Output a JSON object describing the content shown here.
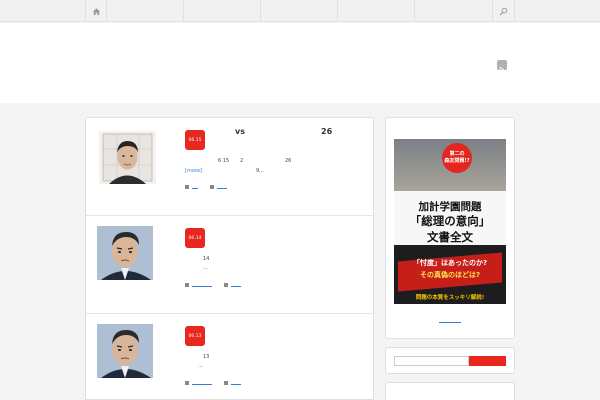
{
  "nav": {
    "home_icon": "home-icon",
    "search_icon": "search-icon"
  },
  "header": {
    "rss_icon": "rss-icon"
  },
  "posts": [
    {
      "date": "06.15",
      "title_a": "vs",
      "title_b": "26",
      "line1_a": "6 15",
      "line1_b": "2",
      "line1_c": "26",
      "more": "[more]",
      "line2_tail": "9..."
    },
    {
      "date": "06.14",
      "line1": "14",
      "line2": "..."
    },
    {
      "date": "06.13",
      "line1": "13",
      "line2": "..."
    }
  ],
  "sidebar": {
    "book": {
      "badge": "第二の\n森友問題!?",
      "title1": "加計学園問題",
      "title2": "「総理の意向」",
      "title3": "文書全文",
      "band1": "「忖度」はあったのか?",
      "band2": "その真偽のほどは?",
      "footer": "問題の本質をスッキリ解説!"
    }
  },
  "colors": {
    "accent": "#e8271e",
    "link": "#3a7bd5"
  }
}
